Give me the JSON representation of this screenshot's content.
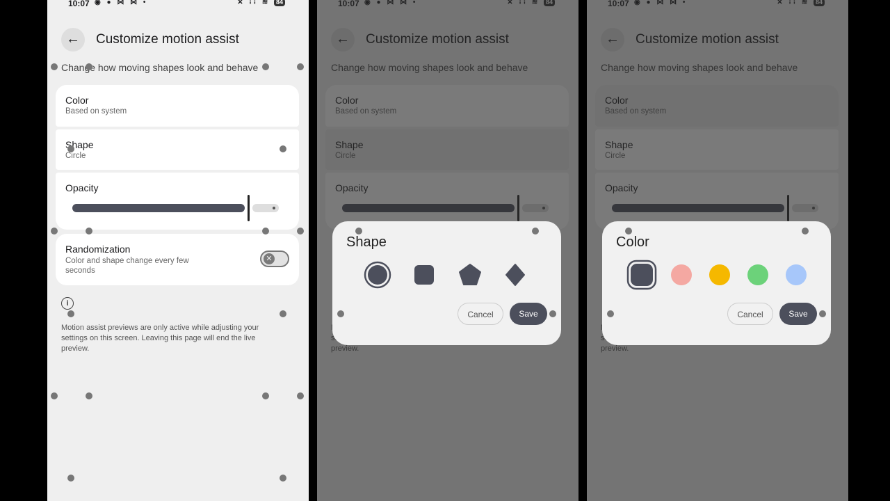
{
  "status": {
    "time": "10:07",
    "battery": "84"
  },
  "settings": {
    "title": "Customize motion assist",
    "subtitle": "Change how moving shapes look and behave",
    "color": {
      "label": "Color",
      "value": "Based on system"
    },
    "shape": {
      "label": "Shape",
      "value": "Circle"
    },
    "opacity": {
      "label": "Opacity",
      "level_percent": 83
    },
    "randomization": {
      "label": "Randomization",
      "description": "Color and shape change every few seconds",
      "enabled": false
    },
    "info": "Motion assist previews are only active while adjusting your settings on this screen. Leaving this page will end the live preview."
  },
  "shape_dialog": {
    "title": "Shape",
    "options": [
      "circle",
      "square",
      "pentagon",
      "diamond"
    ],
    "selected": "circle",
    "cancel": "Cancel",
    "save": "Save"
  },
  "color_dialog": {
    "title": "Color",
    "options": [
      "#4c4f5c",
      "#f4a8a2",
      "#f5b800",
      "#6cd27a",
      "#a7c7fa"
    ],
    "selected": "#4c4f5c",
    "cancel": "Cancel",
    "save": "Save"
  },
  "colors": {
    "accent": "#4c4f5c",
    "background": "#efefef",
    "card": "#ffffff"
  }
}
